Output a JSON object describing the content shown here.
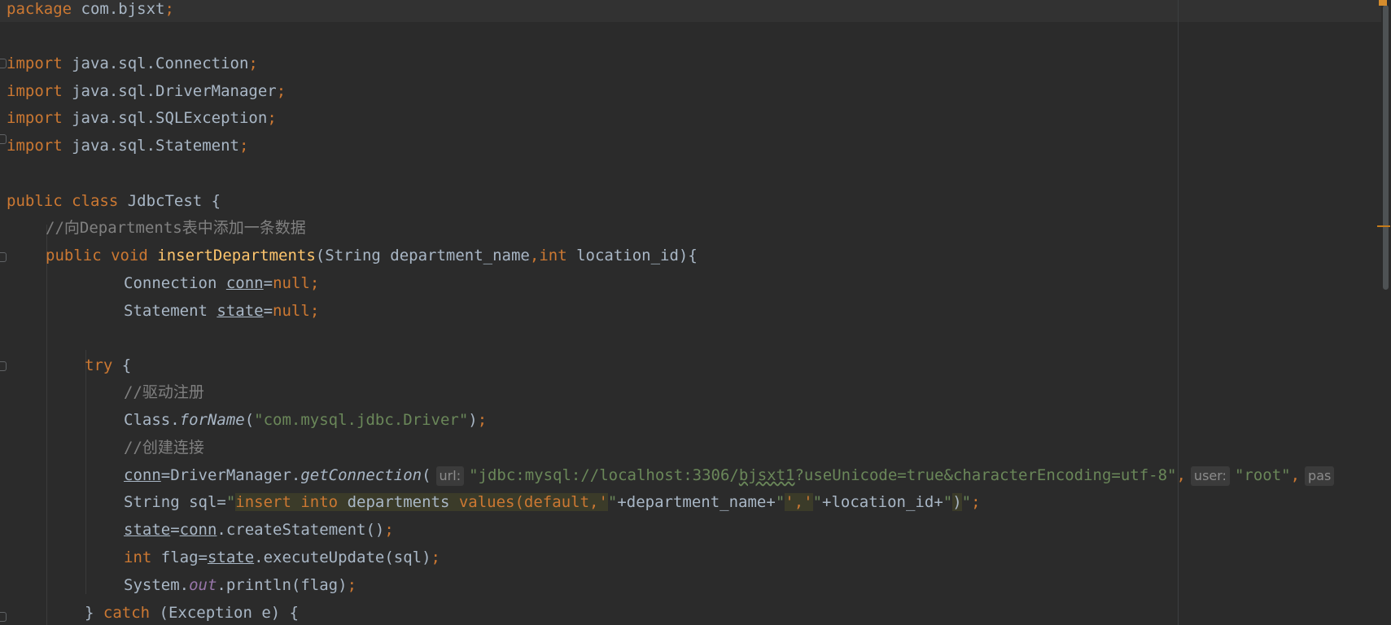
{
  "editor": {
    "line_package": {
      "kw": "package",
      "name": " com.bjsxt",
      "semi": ";"
    },
    "imports": [
      {
        "kw": "import",
        "path": " java.sql.Connection",
        "semi": ";"
      },
      {
        "kw": "import",
        "path": " java.sql.DriverManager",
        "semi": ";"
      },
      {
        "kw": "import",
        "path": " java.sql.SQLException",
        "semi": ";"
      },
      {
        "kw": "import",
        "path": " java.sql.Statement",
        "semi": ";"
      }
    ],
    "class_line": {
      "kw": "public class",
      "name": " JdbcTest {"
    },
    "comment_class": "//向Departments表中添加一条数据",
    "method_line": {
      "kw": "public void",
      "name": "insertDepartments",
      "open": "(String department_name",
      "comma": ",",
      "kw_int": "int",
      "rest": " location_id){"
    },
    "conn_decl": {
      "type": "Connection ",
      "var": "conn",
      "eq": "=",
      "val": "null",
      "semi": ";"
    },
    "state_decl": {
      "type": "Statement ",
      "var": "state",
      "eq": "=",
      "val": "null",
      "semi": ";"
    },
    "try_line": {
      "kw": "try",
      "brace": " {"
    },
    "comment_driver": "//驱动注册",
    "forname": {
      "cls": "Class.",
      "method": "forName",
      "open": "(",
      "arg": "\"com.mysql.jdbc.Driver\"",
      "close": ")",
      "semi": ";"
    },
    "comment_conn": "//创建连接",
    "getconn": {
      "var": "conn",
      "eq": "=DriverManager.",
      "method": "getConnection",
      "open": "(",
      "hint_url": "url:",
      "url_a": "\"jdbc:mysql://localhost:3306/",
      "url_b": "bjsxt1",
      "url_c": "?useUnicode=true&characterEncoding=utf-8\"",
      "comma1": ",",
      "hint_user": "user:",
      "user_val": "\"root\"",
      "comma2": ",",
      "hint_pass": "pas"
    },
    "sql_line": {
      "prefix": "String sql=",
      "q1": "\"",
      "sql_a": "insert into",
      "sql_b": " departments ",
      "sql_c": "values(default,'",
      "q2": "\"",
      "mid1": "+department_name+",
      "q3": "\"",
      "sql_d": "','",
      "q4": "\"",
      "mid2": "+location_id+",
      "q5": "\"",
      "sql_e": ")",
      "q6": "\"",
      "semi": ";"
    },
    "create_stmt": {
      "var": "state",
      "eq": "=",
      "conn": "conn",
      "rest": ".createStatement()",
      "semi": ";"
    },
    "exec_line": {
      "kw": "int",
      "mid": " flag=",
      "var": "state",
      "rest": ".executeUpdate(sql)",
      "semi": ";"
    },
    "print_line": {
      "cls": "System.",
      "field": "out",
      "rest": ".println(flag)",
      "semi": ";"
    },
    "catch_line": {
      "brace": "} ",
      "kw": "catch",
      "rest": " (Exception e) {"
    }
  }
}
